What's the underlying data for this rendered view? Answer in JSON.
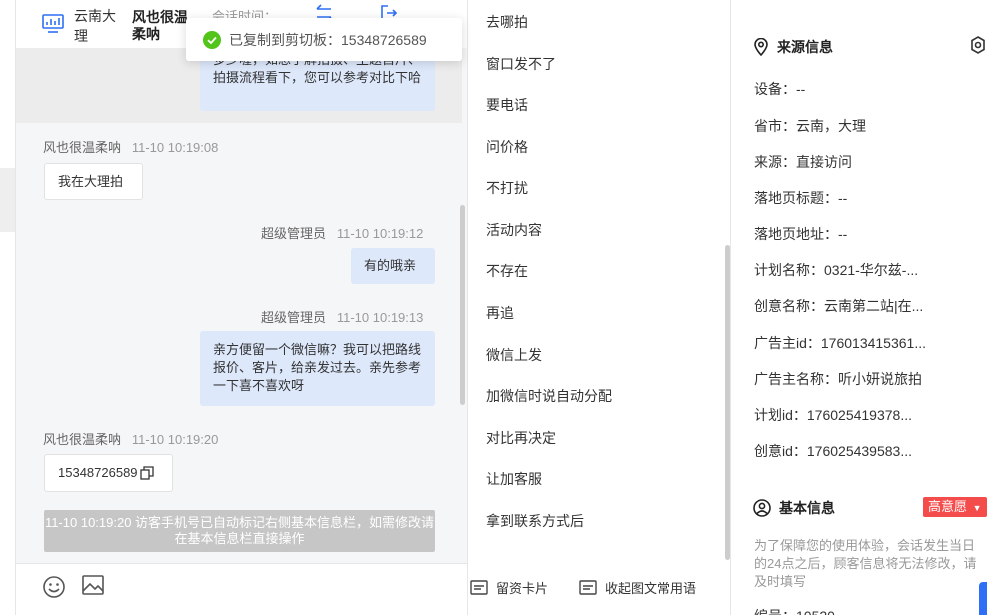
{
  "header": {
    "city": "云南大理",
    "name": "风也很温柔呐",
    "time_label": "会话时间："
  },
  "toast": {
    "text": "已复制到剪切板：15348726589"
  },
  "messages": {
    "top_bubble_partial": "多少喔，如想了解拍摄、主题自片、拍摄流程看下，您可以参考对比下哈",
    "m1_name": "风也很温柔呐",
    "m1_time": "11-10 10:19:08",
    "m1_text": "我在大理拍",
    "m2_name": "超级管理员",
    "m2_time": "11-10 10:19:12",
    "m2_text": "有的哦亲",
    "m3_name": "超级管理员",
    "m3_time": "11-10 10:19:13",
    "m3_text": "亲方便留一个微信嘛？我可以把路线报价、客片，给亲发过去。亲先参考一下喜不喜欢呀",
    "m4_name": "风也很温柔呐",
    "m4_time": "11-10 10:19:20",
    "m4_text": "15348726589",
    "system_note": "11-10 10:19:20 访客手机号已自动标记右侧基本信息栏，如需修改请在基本信息栏直接操作"
  },
  "phrases": [
    "去哪拍",
    "窗口发不了",
    "要电话",
    "问价格",
    "不打扰",
    "活动内容",
    "不存在",
    "再追",
    "微信上发",
    "加微信时说自动分配",
    "对比再决定",
    "让加客服",
    "拿到联系方式后"
  ],
  "bottom_actions": {
    "card": "留资卡片",
    "collapse": "收起图文常用语"
  },
  "info": {
    "source_title": "来源信息",
    "rows": [
      "设备：--",
      "省市：云南，大理",
      "来源：直接访问",
      "落地页标题：--",
      "落地页地址：--",
      "计划名称：0321-华尔兹-...",
      "创意名称：云南第二站|在...",
      "广告主id：176013415361...",
      "广告主名称：听小妍说旅拍",
      "计划id：176025419378...",
      "创意id：176025439583..."
    ],
    "basic_title": "基本信息",
    "badge": "高意愿",
    "note": "为了保障您的使用体验，会话发生当日的24点之后，顾客信息将无法修改，请及时填写",
    "partial_row": "编号：10520"
  },
  "colors": {
    "accent": "#2f6ff5",
    "bubble": "#dde8fb",
    "badge": "#f44b4b",
    "success": "#52c41a"
  }
}
